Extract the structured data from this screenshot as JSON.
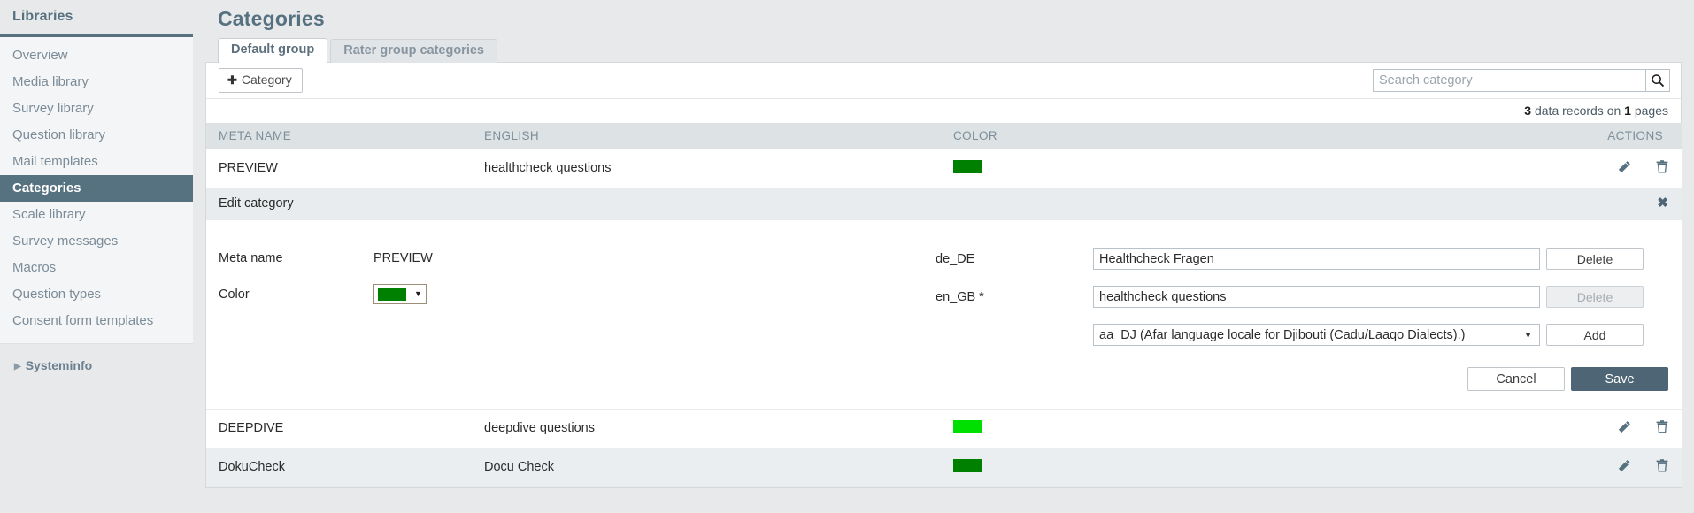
{
  "sidebar": {
    "title": "Libraries",
    "items": [
      {
        "label": "Overview",
        "active": false
      },
      {
        "label": "Media library",
        "active": false
      },
      {
        "label": "Survey library",
        "active": false
      },
      {
        "label": "Question library",
        "active": false
      },
      {
        "label": "Mail templates",
        "active": false
      },
      {
        "label": "Categories",
        "active": true
      },
      {
        "label": "Scale library",
        "active": false
      },
      {
        "label": "Survey messages",
        "active": false
      },
      {
        "label": "Macros",
        "active": false
      },
      {
        "label": "Question types",
        "active": false
      },
      {
        "label": "Consent form templates",
        "active": false
      }
    ],
    "systeminfo": "Systeminfo",
    "systeminfo_caret": "caret-right-icon"
  },
  "page": {
    "title": "Categories"
  },
  "tabs": [
    {
      "label": "Default group",
      "active": true
    },
    {
      "label": "Rater group categories",
      "active": false
    }
  ],
  "toolbar": {
    "add_category_label": "Category",
    "add_category_plus": "plus-icon",
    "search_placeholder": "Search category",
    "search_value": "",
    "search_icon": "search-icon"
  },
  "records": {
    "count": "3",
    "text_middle": " data records on ",
    "pages": "1",
    "text_end": " pages"
  },
  "table": {
    "columns": [
      "META NAME",
      "ENGLISH",
      "COLOR",
      "ACTIONS"
    ],
    "rows": [
      {
        "meta_name": "PREVIEW",
        "english": "healthcheck questions",
        "color": "#008000",
        "edit_icon": "pencil-icon",
        "delete_icon": "trash-icon"
      },
      {
        "meta_name": "DEEPDIVE",
        "english": "deepdive questions",
        "color": "#00e000",
        "edit_icon": "pencil-icon",
        "delete_icon": "trash-icon"
      },
      {
        "meta_name": "DokuCheck",
        "english": "Docu Check",
        "color": "#008000",
        "edit_icon": "pencil-icon",
        "delete_icon": "trash-icon"
      }
    ]
  },
  "edit_panel": {
    "heading": "Edit category",
    "close_icon": "close-icon",
    "meta_name_label": "Meta name",
    "meta_name_value": "PREVIEW",
    "color_label": "Color",
    "color_value": "#008000",
    "color_dropdown_caret": "chevron-down-icon",
    "translations": [
      {
        "locale": "de_DE",
        "value": "Healthcheck Fragen",
        "delete_label": "Delete",
        "delete_disabled": false
      },
      {
        "locale": "en_GB *",
        "value": "healthcheck questions",
        "delete_label": "Delete",
        "delete_disabled": true
      }
    ],
    "locale_select_value": "aa_DJ (Afar language locale for Djibouti (Cadu/Laaqo Dialects).)",
    "locale_select_options": [
      "aa_DJ (Afar language locale for Djibouti (Cadu/Laaqo Dialects).)"
    ],
    "add_label": "Add",
    "cancel_label": "Cancel",
    "save_label": "Save"
  },
  "colors": {
    "brand": "#56717f",
    "sidebar_bg": "#e7e9ea",
    "nav_bg": "#f4f5f6",
    "panel_bg": "#ffffff",
    "header_row_bg": "#dde2e5",
    "alt_row_bg": "#eaeef0",
    "save_button_bg": "#4e6575"
  }
}
